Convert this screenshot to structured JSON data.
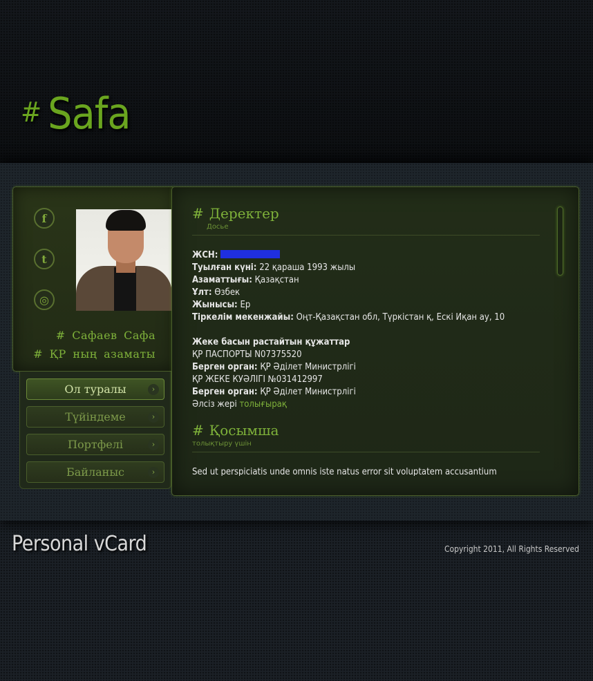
{
  "header": {
    "hash": "#",
    "title": "Safa"
  },
  "social": [
    {
      "name": "facebook-icon",
      "glyph": "f"
    },
    {
      "name": "twitter-icon",
      "glyph": "t"
    },
    {
      "name": "dribbble-icon",
      "glyph": "◎"
    }
  ],
  "profile": {
    "name": "# Сафаев Сафа",
    "subtitle": "# ҚР ның азаматы"
  },
  "nav": [
    {
      "label": "Ол туралы",
      "active": true
    },
    {
      "label": "Түйіндеме",
      "active": false
    },
    {
      "label": "Портфелі",
      "active": false
    },
    {
      "label": "Байланыс",
      "active": false
    }
  ],
  "sections": {
    "details": {
      "hash": "#",
      "title": "Деректер",
      "subtitle": "Досье",
      "lines": [
        {
          "label": "ЖСН:",
          "value": ""
        },
        {
          "label": "Туылған күні:",
          "value": "22 қараша 1993 жылы"
        },
        {
          "label": "Азаматтығы:",
          "value": "Қазақстан"
        },
        {
          "label": "Ұлт:",
          "value": "Өзбек"
        },
        {
          "label": "Жынысы:",
          "value": "Ер"
        },
        {
          "label": "Тіркелім мекенжайы:",
          "value": "Оңт-Қазақстан обл, Түркістан қ, Ескі Иқан ау, 10"
        }
      ],
      "docs_heading": "Жеке басын растайтын құжаттар",
      "passport": "ҚР ПАСПОРТЫ N07375520",
      "issuer_label": "Берген орган:",
      "issuer_value": "ҚР Әділет Министрлігі",
      "id_card": "ҚР ЖЕКЕ КУӘЛІГІ №031412997",
      "issuer2_label": "Берген орган:",
      "issuer2_value": "ҚР Әділет Министрлігі",
      "weak_prefix": "Әлсіз жері",
      "weak_link": "толығырақ"
    },
    "extra": {
      "hash": "#",
      "title": "Қосымша",
      "subtitle": "толықтыру үшін",
      "text": "Sed ut perspiciatis unde omnis iste natus error sit voluptatem accusantium"
    }
  },
  "footer": {
    "title": "Personal vCard",
    "copyright": "Copyright 2011, All Rights Reserved"
  }
}
